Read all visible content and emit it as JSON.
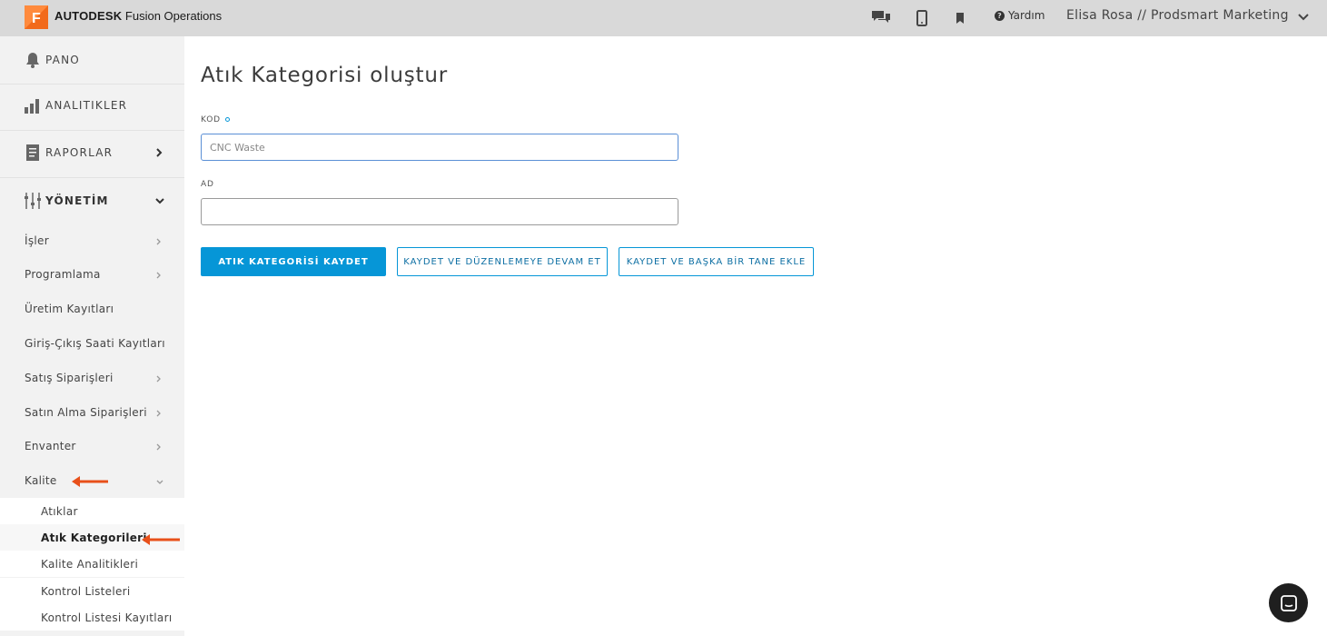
{
  "topbar": {
    "logo_letter": "F",
    "brand_bold": "AUTODESK",
    "brand_rest": " Fusion Operations",
    "help_label": "Yardım",
    "user_label": "Elisa Rosa // Prodsmart Marketing",
    "icons": [
      "chat-icon",
      "mobile-icon",
      "bookmark-icon",
      "help-icon",
      "chevron-down-icon"
    ]
  },
  "sidebar": {
    "main": [
      {
        "label": "PANO",
        "icon": "bell-icon"
      },
      {
        "label": "ANALITIKLER",
        "icon": "bar-chart-icon"
      },
      {
        "label": "RAPORLAR",
        "icon": "report-icon"
      },
      {
        "label": "YÖNETİM",
        "icon": "sliders-icon"
      }
    ],
    "items": [
      {
        "label": "İşler"
      },
      {
        "label": "Programlama"
      },
      {
        "label": "Üretim Kayıtları"
      },
      {
        "label": "Giriş-Çıkış Saati Kayıtları"
      },
      {
        "label": "Satış Siparişleri"
      },
      {
        "label": "Satın Alma Siparişleri"
      },
      {
        "label": "Envanter"
      },
      {
        "label": "Kalite"
      }
    ],
    "quality_items": [
      {
        "label": "Atıklar"
      },
      {
        "label": "Atık Kategorileri",
        "active": true
      },
      {
        "label": "Kalite Analitikleri"
      },
      {
        "label": "Kontrol Listeleri"
      },
      {
        "label": "Kontrol Listesi Kayıtları"
      }
    ]
  },
  "main": {
    "title": "Atık Kategorisi oluştur",
    "code_label": "KOD",
    "code_placeholder": "CNC Waste",
    "code_value": "",
    "name_label": "AD",
    "name_value": "",
    "save_button": "ATIK KATEGORİSİ KAYDET",
    "save_continue_button": "KAYDET VE DÜZENLEMEYE DEVAM ET",
    "save_add_button": "KAYDET VE BAŞKA BİR TANE EKLE"
  },
  "colors": {
    "accent": "#0696d7",
    "logo": "#f26a1b",
    "annotation_arrow": "#e8501a",
    "topbar": "#d9d9d9",
    "sidebar": "#f2f2f2"
  }
}
